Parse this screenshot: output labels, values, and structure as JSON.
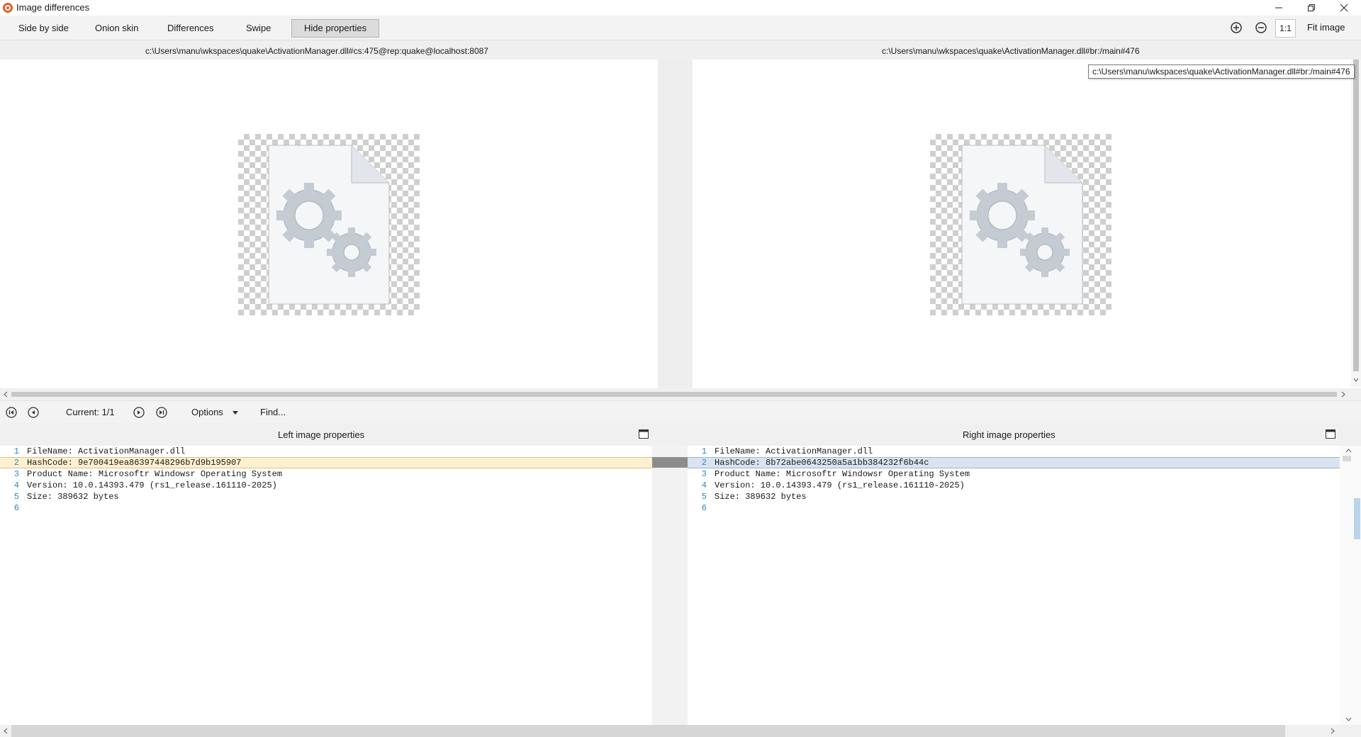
{
  "window": {
    "title": "Image differences"
  },
  "toolbar": {
    "side_by_side": "Side by side",
    "onion_skin": "Onion skin",
    "differences": "Differences",
    "swipe": "Swipe",
    "hide_properties": "Hide properties",
    "zoom_one": "1:1",
    "fit_image": "Fit image"
  },
  "paths": {
    "left": "c:\\Users\\manu\\wkspaces\\quake\\ActivationManager.dll#cs:475@rep:quake@localhost:8087",
    "right": "c:\\Users\\manu\\wkspaces\\quake\\ActivationManager.dll#br:/main#476",
    "tooltip": "c:\\Users\\manu\\wkspaces\\quake\\ActivationManager.dll#br:/main#476"
  },
  "navigation": {
    "current": "Current: 1/1",
    "options": "Options",
    "find": "Find..."
  },
  "properties": {
    "left_title": "Left image properties",
    "right_title": "Right image properties",
    "left_lines": [
      {
        "n": "1",
        "text": "FileName: ActivationManager.dll"
      },
      {
        "n": "2",
        "text": "HashCode: 9e700419ea86397448296b7d9b195907"
      },
      {
        "n": "3",
        "text": "Product Name: Microsoftr Windowsr Operating System"
      },
      {
        "n": "4",
        "text": "Version: 10.0.14393.479 (rs1_release.161110-2025)"
      },
      {
        "n": "5",
        "text": "Size: 389632 bytes"
      },
      {
        "n": "6",
        "text": ""
      }
    ],
    "right_lines": [
      {
        "n": "1",
        "text": "FileName: ActivationManager.dll"
      },
      {
        "n": "2",
        "text": "HashCode: 8b72abe0643250a5a1bb384232f6b44c"
      },
      {
        "n": "3",
        "text": "Product Name: Microsoftr Windowsr Operating System"
      },
      {
        "n": "4",
        "text": "Version: 10.0.14393.479 (rs1_release.161110-2025)"
      },
      {
        "n": "5",
        "text": "Size: 389632 bytes"
      },
      {
        "n": "6",
        "text": ""
      }
    ]
  },
  "colors": {
    "accent_orange": "#e0602b",
    "highlight_left": "#fdf0cf",
    "highlight_right": "#d9e4f0",
    "line_number": "#2b88c8"
  },
  "icons": [
    "app-logo-icon",
    "minimize-icon",
    "restore-icon",
    "close-icon",
    "zoom-in-icon",
    "zoom-out-icon",
    "first-diff-icon",
    "prev-diff-icon",
    "next-diff-icon",
    "last-diff-icon",
    "dropdown-arrow-icon",
    "maximize-panel-icon",
    "file-gear-icon"
  ]
}
